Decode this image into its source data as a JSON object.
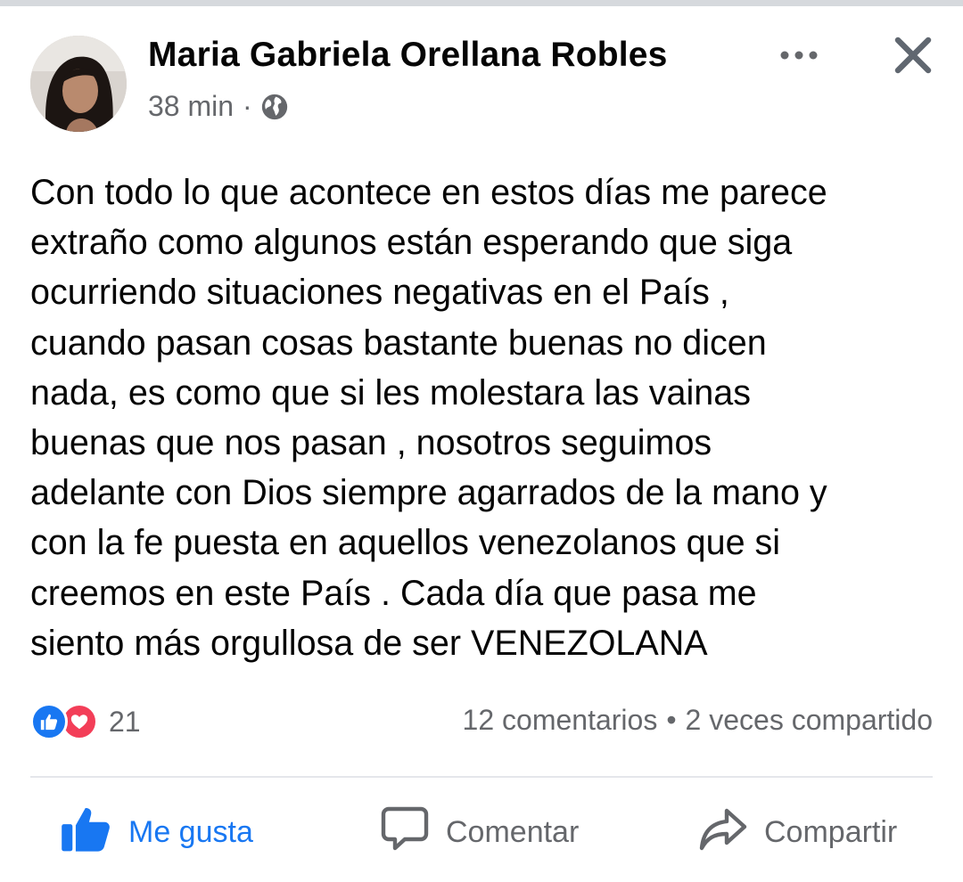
{
  "post": {
    "author": "Maria Gabriela Orellana Robles",
    "time": "38 min",
    "separator": "·",
    "privacy_icon": "globe-icon",
    "text": "Con todo lo que acontece en estos días me parece\nextraño como algunos están esperando que siga\nocurriendo situaciones negativas en el País ,\ncuando pasan cosas bastante buenas no dicen\nnada, es como que si les molestara las vainas\nbuenas que nos pasan , nosotros seguimos\nadelante con Dios siempre agarrados de la mano y\ncon la fe puesta en aquellos venezolanos que si\ncreemos en este País . Cada día que pasa me\nsiento más orgullosa de ser VENEZOLANA"
  },
  "header": {
    "more_icon": "more-options-icon",
    "close_icon": "close-icon"
  },
  "stats": {
    "reaction_icons": [
      "like-reaction-icon",
      "love-reaction-icon"
    ],
    "reaction_count": "21",
    "comments": "12 comentarios",
    "bullet": "•",
    "shares": "2 veces compartido"
  },
  "actions": {
    "like_label": "Me gusta",
    "comment_label": "Comentar",
    "share_label": "Compartir"
  },
  "colors": {
    "accent": "#1877f2",
    "love": "#f33e58",
    "secondary_text": "#65676b",
    "divider": "#e4e6eb"
  }
}
